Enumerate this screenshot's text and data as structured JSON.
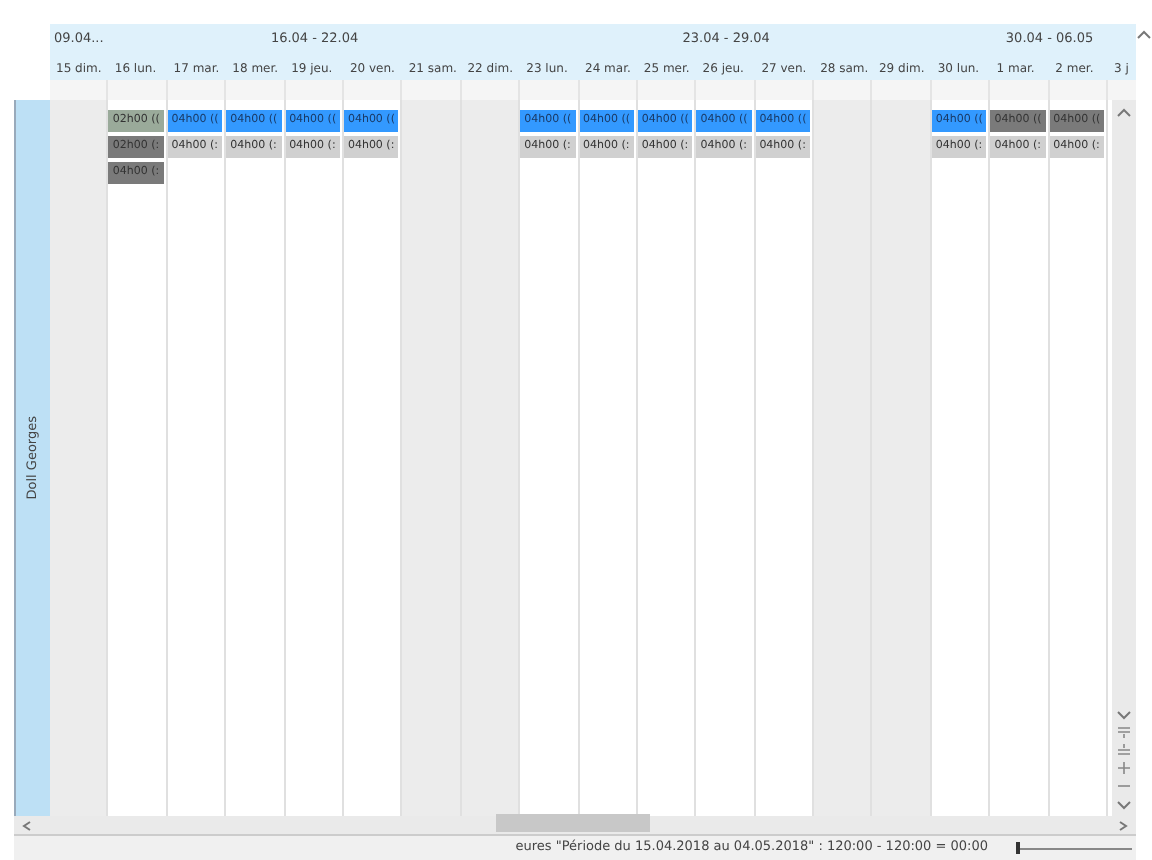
{
  "resource": {
    "name": "Doll Georges"
  },
  "weeks": [
    {
      "label": "09.04...",
      "days": [
        {
          "label": "15 dim.",
          "weekend": true
        }
      ]
    },
    {
      "label": "16.04 - 22.04",
      "days": [
        {
          "label": "16 lun.",
          "weekend": false,
          "slots": [
            {
              "text": "02h00 ((",
              "color": "#9aaa9a"
            },
            {
              "text": "02h00 (:",
              "color": "#7a7a7a"
            },
            {
              "text": "04h00 (:",
              "color": "#7a7a7a"
            }
          ]
        },
        {
          "label": "17 mar.",
          "weekend": false,
          "slots": [
            {
              "text": "04h00 ((",
              "color": "#3399ff"
            },
            {
              "text": "04h00 (:",
              "color": "#d0d0d0"
            }
          ]
        },
        {
          "label": "18 mer.",
          "weekend": false,
          "slots": [
            {
              "text": "04h00 ((",
              "color": "#3399ff"
            },
            {
              "text": "04h00 (:",
              "color": "#d0d0d0"
            }
          ]
        },
        {
          "label": "19 jeu.",
          "weekend": false,
          "slots": [
            {
              "text": "04h00 ((",
              "color": "#3399ff"
            },
            {
              "text": "04h00 (:",
              "color": "#d0d0d0"
            }
          ]
        },
        {
          "label": "20 ven.",
          "weekend": false,
          "slots": [
            {
              "text": "04h00 ((",
              "color": "#3399ff"
            },
            {
              "text": "04h00 (:",
              "color": "#d0d0d0"
            }
          ]
        },
        {
          "label": "21 sam.",
          "weekend": true
        },
        {
          "label": "22 dim.",
          "weekend": true
        }
      ]
    },
    {
      "label": "23.04 - 29.04",
      "days": [
        {
          "label": "23 lun.",
          "weekend": false,
          "slots": [
            {
              "text": "04h00 ((",
              "color": "#3399ff"
            },
            {
              "text": "04h00 (:",
              "color": "#d0d0d0"
            }
          ]
        },
        {
          "label": "24 mar.",
          "weekend": false,
          "slots": [
            {
              "text": "04h00 ((",
              "color": "#3399ff"
            },
            {
              "text": "04h00 (:",
              "color": "#d0d0d0"
            }
          ]
        },
        {
          "label": "25 mer.",
          "weekend": false,
          "slots": [
            {
              "text": "04h00 ((",
              "color": "#3399ff"
            },
            {
              "text": "04h00 (:",
              "color": "#d0d0d0"
            }
          ]
        },
        {
          "label": "26 jeu.",
          "weekend": false,
          "slots": [
            {
              "text": "04h00 ((",
              "color": "#3399ff"
            },
            {
              "text": "04h00 (:",
              "color": "#d0d0d0"
            }
          ]
        },
        {
          "label": "27 ven.",
          "weekend": false,
          "slots": [
            {
              "text": "04h00 ((",
              "color": "#3399ff"
            },
            {
              "text": "04h00 (:",
              "color": "#d0d0d0"
            }
          ]
        },
        {
          "label": "28 sam.",
          "weekend": true
        },
        {
          "label": "29 dim.",
          "weekend": true
        }
      ]
    },
    {
      "label": "30.04 - 06.05",
      "days": [
        {
          "label": "30 lun.",
          "weekend": false,
          "slots": [
            {
              "text": "04h00 ((",
              "color": "#3399ff"
            },
            {
              "text": "04h00 (:",
              "color": "#d0d0d0"
            }
          ]
        },
        {
          "label": "1 mar.",
          "weekend": false,
          "slots": [
            {
              "text": "04h00 ((",
              "color": "#7a7a7a"
            },
            {
              "text": "04h00 (:",
              "color": "#d0d0d0"
            }
          ]
        },
        {
          "label": "2 mer.",
          "weekend": false,
          "slots": [
            {
              "text": "04h00 ((",
              "color": "#7a7a7a"
            },
            {
              "text": "04h00 (:",
              "color": "#d0d0d0"
            }
          ]
        },
        {
          "label": "3 j",
          "weekend": false
        }
      ]
    }
  ],
  "status_bar": {
    "text": "eures \"Période du 15.04.2018 au 04.05.2018\" : 120:00 - 120:00 = 00:00",
    "zoom": {
      "level": 0.0
    }
  }
}
